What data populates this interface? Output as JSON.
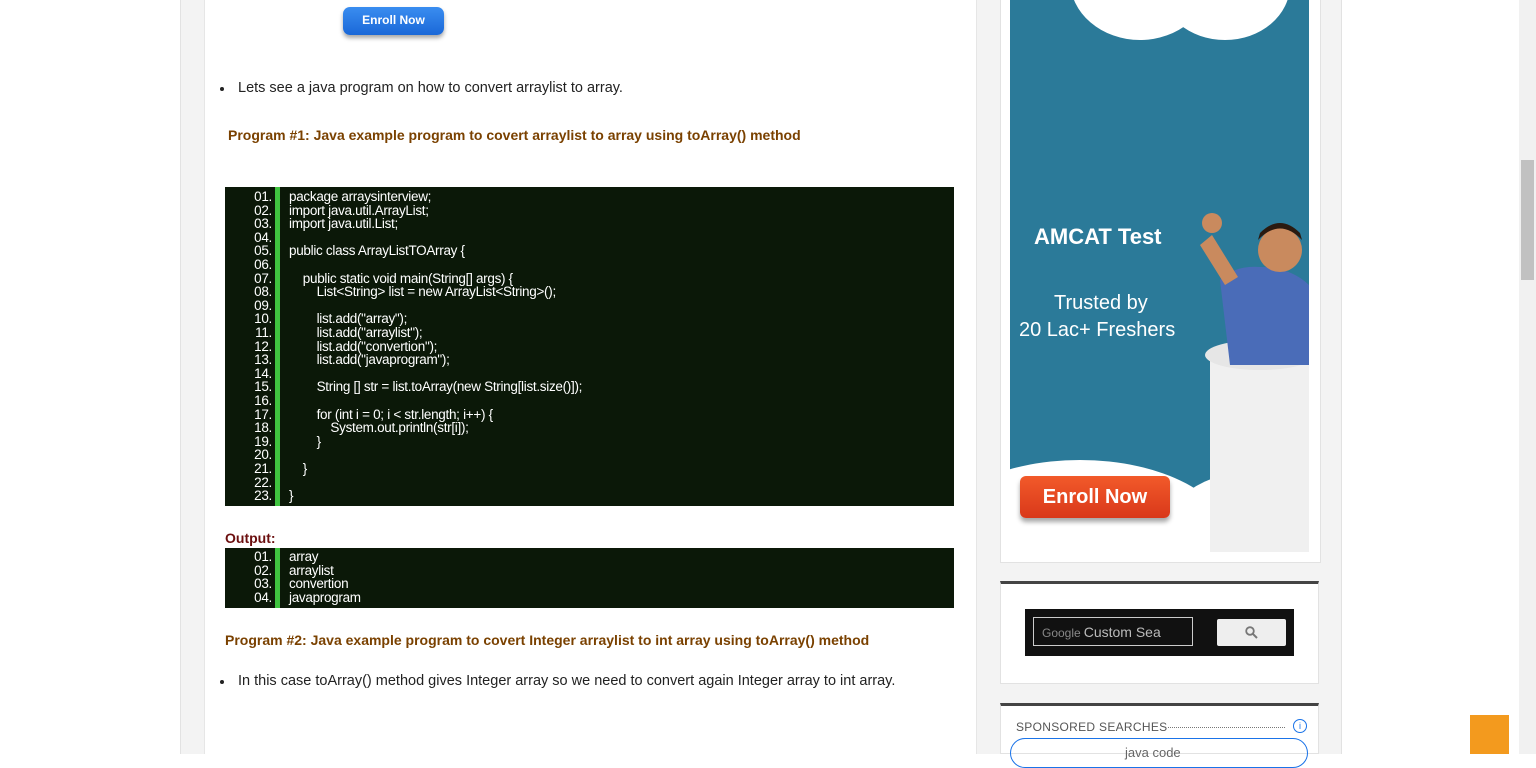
{
  "article": {
    "enroll_top": "Enroll Now",
    "bullet1": "Lets see a java program on how to convert arraylist to array.",
    "program1_heading": "Program #1: Java example program to covert arraylist to array using toArray() method",
    "code1": [
      {
        "n": "01.",
        "t": "package arraysinterview;"
      },
      {
        "n": "02.",
        "t": "import java.util.ArrayList;"
      },
      {
        "n": "03.",
        "t": "import java.util.List;"
      },
      {
        "n": "04.",
        "t": ""
      },
      {
        "n": "05.",
        "t": "public class ArrayListTOArray {"
      },
      {
        "n": "06.",
        "t": ""
      },
      {
        "n": "07.",
        "t": "    public static void main(String[] args) {"
      },
      {
        "n": "08.",
        "t": "        List<String> list = new ArrayList<String>();"
      },
      {
        "n": "09.",
        "t": ""
      },
      {
        "n": "10.",
        "t": "        list.add(\"array\");"
      },
      {
        "n": "11.",
        "t": "        list.add(\"arraylist\");"
      },
      {
        "n": "12.",
        "t": "        list.add(\"convertion\");"
      },
      {
        "n": "13.",
        "t": "        list.add(\"javaprogram\");"
      },
      {
        "n": "14.",
        "t": ""
      },
      {
        "n": "15.",
        "t": "        String [] str = list.toArray(new String[list.size()]);"
      },
      {
        "n": "16.",
        "t": ""
      },
      {
        "n": "17.",
        "t": "        for (int i = 0; i < str.length; i++) {"
      },
      {
        "n": "18.",
        "t": "            System.out.println(str[i]);"
      },
      {
        "n": "19.",
        "t": "        }"
      },
      {
        "n": "20.",
        "t": ""
      },
      {
        "n": "21.",
        "t": "    }"
      },
      {
        "n": "22.",
        "t": ""
      },
      {
        "n": "23.",
        "t": "}"
      }
    ],
    "output_label": "Output:",
    "output": [
      {
        "n": "01.",
        "t": "array"
      },
      {
        "n": "02.",
        "t": "arraylist"
      },
      {
        "n": "03.",
        "t": "convertion"
      },
      {
        "n": "04.",
        "t": "javaprogram"
      }
    ],
    "program2_heading": "Program #2: Java example program to covert Integer arraylist to int array using toArray() method",
    "bullet2": "In this case toArray() method gives Integer array so we need to convert again Integer array to int array."
  },
  "sidebar": {
    "ad": {
      "title": "AMCAT Test",
      "line1": "Trusted by",
      "line2": "20 Lac+ Freshers",
      "button": "Enroll Now",
      "bg_color": "#2b7a99"
    },
    "search": {
      "brand": "Google",
      "placeholder": "Custom Sea"
    },
    "sponsored": {
      "label": "SPONSORED SEARCHES",
      "item": "java code"
    }
  },
  "colors": {
    "code_bg": "#0b1808",
    "line_bar": "#3fc33f",
    "heading": "#7a4100",
    "scroll_top": "#f39a1e"
  }
}
